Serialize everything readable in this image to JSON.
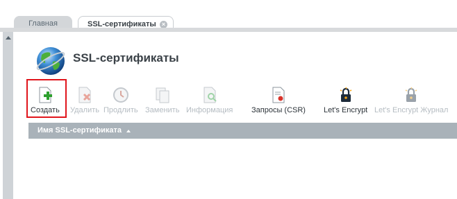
{
  "tabs": [
    {
      "label": "Главная"
    },
    {
      "label": "SSL-сертификаты",
      "close": "×"
    }
  ],
  "page": {
    "title": "SSL-сертификаты",
    "icon": "globe-icon"
  },
  "toolbar": {
    "create": {
      "label": "Создать",
      "icon": "certificate-add-icon",
      "enabled": true,
      "highlighted": true
    },
    "delete": {
      "label": "Удалить",
      "icon": "certificate-delete-icon",
      "enabled": false
    },
    "renew": {
      "label": "Продлить",
      "icon": "clock-icon",
      "enabled": false
    },
    "replace": {
      "label": "Заменить",
      "icon": "documents-icon",
      "enabled": false
    },
    "info": {
      "label": "Информация",
      "icon": "document-search-icon",
      "enabled": false
    },
    "csr": {
      "label": "Запросы (CSR)",
      "icon": "certificate-request-icon",
      "enabled": true
    },
    "letsencrypt": {
      "label": "Let's Encrypt",
      "icon": "lock-icon",
      "enabled": true
    },
    "le_journal": {
      "label": "Let's Encrypt Журнал",
      "icon": "lock-journal-icon",
      "enabled": false
    }
  },
  "grid": {
    "column": "Имя SSL-сертификата",
    "sort": "ascending"
  },
  "colors": {
    "highlight": "#e0141b",
    "header": "#a9b2b9",
    "disabled_text": "#b5bcc2"
  }
}
